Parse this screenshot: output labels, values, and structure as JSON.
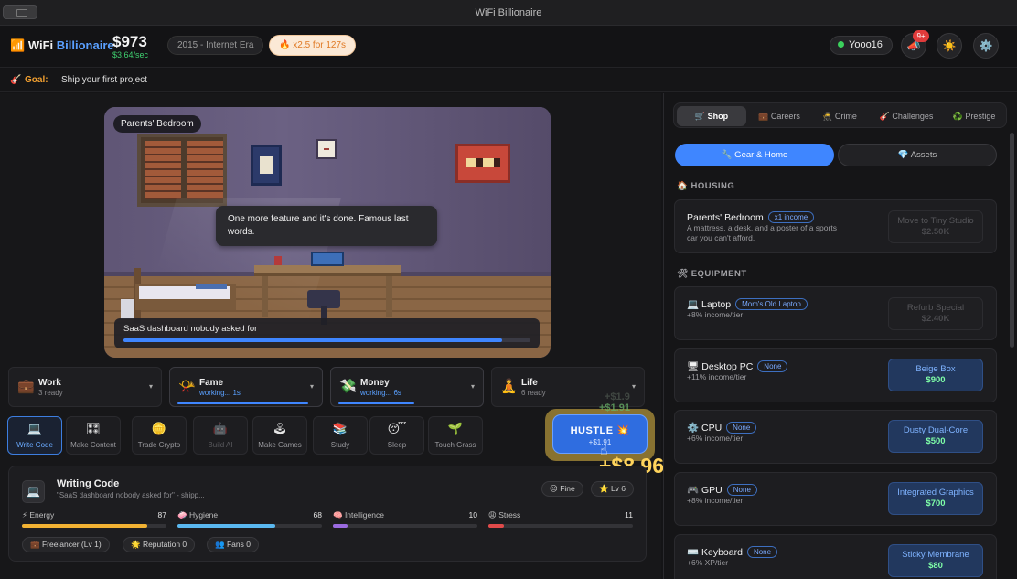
{
  "window": {
    "title": "WiFi Billionaire"
  },
  "header": {
    "logo_icon": "📶",
    "logo_a": "WiFi",
    "logo_b": "Billionaire",
    "money": "$973",
    "rate": "$3.64/sec",
    "era": "2015 - Internet Era",
    "boost": "🔥 x2.5 for 127s",
    "username": "Yooo16",
    "notif_icon": "📣",
    "notif_badge": "9+",
    "theme_icon": "☀️",
    "settings_icon": "⚙️"
  },
  "goal": {
    "icon": "🎸",
    "label": "Goal:",
    "text": "Ship your first project"
  },
  "scene": {
    "location": "Parents' Bedroom",
    "speech": "One more feature and it's done. Famous last words.",
    "task": "SaaS dashboard nobody asked for",
    "task_progress_pct": 93
  },
  "categories": [
    {
      "icon": "💼",
      "name": "Work",
      "status": "3 ready",
      "active": false
    },
    {
      "icon": "📯",
      "name": "Fame",
      "status": "working... 1s",
      "active": true,
      "progress_pct": 95
    },
    {
      "icon": "💸",
      "name": "Money",
      "status": "working... 6s",
      "active": true,
      "progress_pct": 55
    },
    {
      "icon": "🧘",
      "name": "Life",
      "status": "6 ready",
      "active": false
    }
  ],
  "chevron": "▾",
  "actions": [
    {
      "icon": "💻",
      "label": "Write Code"
    },
    {
      "icon": "🎛",
      "label": "Make Content"
    },
    {
      "icon": "🪙",
      "label": "Trade Crypto"
    },
    {
      "icon": "🤖",
      "label": "Build AI"
    },
    {
      "icon": "🕹",
      "label": "Make Games"
    },
    {
      "icon": "📚",
      "label": "Study"
    },
    {
      "icon": "😴",
      "label": "Sleep"
    },
    {
      "icon": "🌱",
      "label": "Touch Grass"
    }
  ],
  "hustle": {
    "label": "HUSTLE",
    "icon": "💥",
    "sub": "+$1.91",
    "popup_big": "+$8.96",
    "popup_small": "+$1.91",
    "popup_faint": "+$1.9"
  },
  "current": {
    "icon": "💻",
    "name": "Writing Code",
    "desc": "\"SaaS dashboard nobody asked for\" - shipp...",
    "mood": "😐 Fine",
    "level": "⭐ Lv 6",
    "meters": [
      {
        "label": "⚡ Energy",
        "value": 87,
        "color": "#f2b233"
      },
      {
        "label": "🧼 Hygiene",
        "value": 68,
        "color": "#5ab8f0"
      },
      {
        "label": "🧠 Intelligence",
        "value": 10,
        "color": "#9a6ae0"
      },
      {
        "label": "😩 Stress",
        "value": 11,
        "color": "#e04a4a"
      }
    ],
    "career": "💼 Freelancer (Lv 1)",
    "reputation": "🌟 Reputation 0",
    "fans": "👥 Fans 0"
  },
  "shop": {
    "tabs": [
      "🛒 Shop",
      "💼 Careers",
      "🥷 Crime",
      "🎸 Challenges",
      "♻️ Prestige"
    ],
    "subtabs": [
      "🔧 Gear & Home",
      "💎 Assets"
    ],
    "housing_label": "🏠 HOUSING",
    "equipment_label": "🛠 EQUIPMENT",
    "housing": {
      "name": "Parents' Bedroom",
      "tag": "x1 income",
      "desc_line1": "A mattress, a desk, and a poster of a sports",
      "desc_line2": "car you can't afford.",
      "btn": "Move to Tiny Studio",
      "price": "$2.50K"
    },
    "items": [
      {
        "icon": "💻",
        "name": "Laptop",
        "tag": "Mom's Old Laptop",
        "desc": "+8% income/tier",
        "btn": "Refurb Special",
        "price": "$2.40K",
        "disabled": true
      },
      {
        "icon": "🖥",
        "name": "Desktop PC",
        "tag": "None",
        "desc": "+11% income/tier",
        "btn": "Beige Box",
        "price": "$900",
        "disabled": false
      },
      {
        "icon": "⚙️",
        "name": "CPU",
        "tag": "None",
        "desc": "+6% income/tier",
        "btn": "Dusty Dual-Core",
        "price": "$500",
        "disabled": false
      },
      {
        "icon": "🎮",
        "name": "GPU",
        "tag": "None",
        "desc": "+8% income/tier",
        "btn": "Integrated Graphics",
        "price": "$700",
        "disabled": false
      },
      {
        "icon": "⌨️",
        "name": "Keyboard",
        "tag": "None",
        "desc": "+6% XP/tier",
        "btn": "Sticky Membrane",
        "price": "$80",
        "disabled": false
      }
    ]
  }
}
